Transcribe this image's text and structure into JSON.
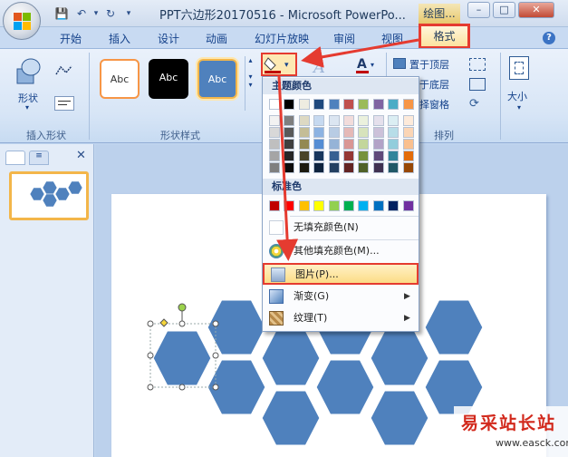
{
  "window": {
    "title": "PPT六边形20170516 - Microsoft PowerPo...",
    "context_tab_header": "绘图...",
    "buttons": {
      "minimize": "–",
      "maximize": "□",
      "close": "✕"
    }
  },
  "tabs": [
    {
      "label": "开始"
    },
    {
      "label": "插入"
    },
    {
      "label": "设计"
    },
    {
      "label": "动画"
    },
    {
      "label": "幻灯片放映"
    },
    {
      "label": "审阅"
    },
    {
      "label": "视图"
    },
    {
      "label": "格式"
    }
  ],
  "ribbon": {
    "insert_shape": {
      "label": "插入形状",
      "shapes_btn": "形状"
    },
    "shape_styles": {
      "label": "形状样式",
      "styles": [
        "Abc",
        "Abc",
        "Abc"
      ]
    },
    "arrange": {
      "label": "排列",
      "bring_front": "置于顶层",
      "send_back": "置于底层",
      "selection_pane": "选择窗格"
    },
    "size": {
      "label": "大小"
    }
  },
  "dropdown": {
    "theme_colors_header": "主题颜色",
    "standard_colors_header": "标准色",
    "theme_top_row": [
      "#ffffff",
      "#000000",
      "#eeece1",
      "#1f497d",
      "#4f81bd",
      "#c0504d",
      "#9bbb59",
      "#8064a2",
      "#4bacc6",
      "#f79646"
    ],
    "theme_shades": [
      [
        "#f2f2f2",
        "#7f7f7f",
        "#ddd9c3",
        "#c6d9f0",
        "#dbe5f1",
        "#f2dcdb",
        "#ebf1dd",
        "#e5e0ec",
        "#dbeef3",
        "#fdeada"
      ],
      [
        "#d8d8d8",
        "#595959",
        "#c4bd97",
        "#8db3e2",
        "#b8cce4",
        "#e5b9b7",
        "#d7e3bc",
        "#ccc1d9",
        "#b7dde8",
        "#fbd5b5"
      ],
      [
        "#bfbfbf",
        "#3f3f3f",
        "#938953",
        "#548dd4",
        "#95b3d7",
        "#d99694",
        "#c3d69b",
        "#b2a2c7",
        "#92cddc",
        "#fac08f"
      ],
      [
        "#a5a5a5",
        "#262626",
        "#494429",
        "#17365d",
        "#366092",
        "#953734",
        "#76923c",
        "#5f497a",
        "#31859b",
        "#e36c09"
      ],
      [
        "#7f7f7f",
        "#0c0c0c",
        "#1d1b10",
        "#0f243e",
        "#244061",
        "#632423",
        "#4f6128",
        "#3f3151",
        "#205867",
        "#974806"
      ]
    ],
    "standard_colors": [
      "#c00000",
      "#ff0000",
      "#ffc000",
      "#ffff00",
      "#92d050",
      "#00b050",
      "#00b0f0",
      "#0070c0",
      "#002060",
      "#7030a0"
    ],
    "items": {
      "no_fill": "无填充颜色(N)",
      "more_colors": "其他填充颜色(M)...",
      "picture": "图片(P)...",
      "gradient": "渐变(G)",
      "texture": "纹理(T)"
    }
  },
  "colors": {
    "hexagon": "#4f81bd",
    "highlight": "#e53b30",
    "accent_tab": "#fbe3a0"
  },
  "watermark": {
    "brand": "易采站长站",
    "url": "www.easck.com"
  }
}
